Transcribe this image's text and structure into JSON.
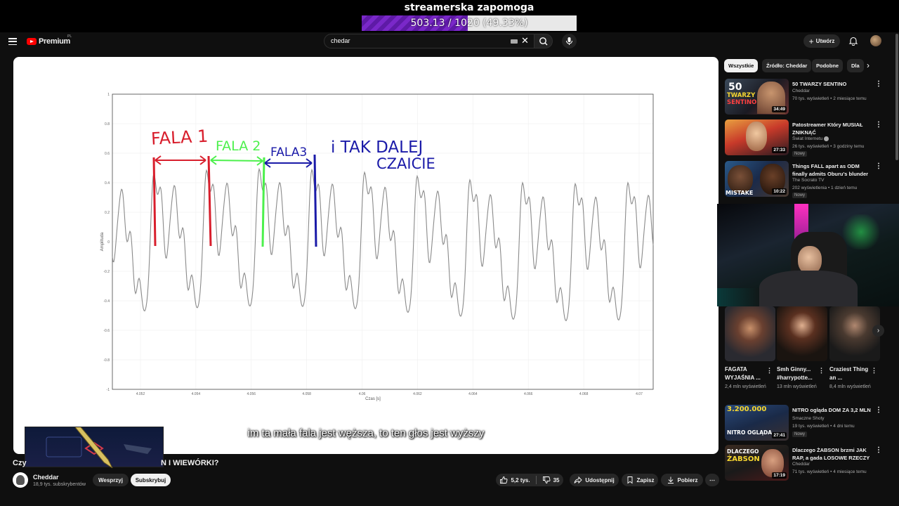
{
  "goal": {
    "title": "streamerska zapomoga",
    "progress_text": "503.13 / 1020 (49.33%)",
    "progress": 0.4933
  },
  "header": {
    "logo_text": "Premium",
    "region": "PL",
    "search_value": "chedar",
    "create_label": "Utwórz"
  },
  "video": {
    "subtitle": "im ta mała fala jest węższa, to ten głos jest wyższy",
    "title_start": "Czy",
    "title_end": "N I WIEWÓRKI?",
    "annotations": {
      "wave1": "FALA 1",
      "wave2": "FALA 2",
      "wave3": "FALA3",
      "rest_line1": "i TAK DALEJ",
      "rest_line2": "CZAICIE"
    }
  },
  "channel": {
    "name": "Cheddar",
    "subs": "18,9 tys. subskrybentów",
    "support_label": "Wesprzyj",
    "subscribe_label": "Subskrybuj"
  },
  "actions": {
    "likes": "5,2 tys.",
    "dislikes": "35",
    "share": "Udostępnij",
    "save": "Zapisz",
    "download": "Pobierz"
  },
  "chips": [
    "Wszystkie",
    "Źródło: Cheddar",
    "Podobne",
    "Dla"
  ],
  "recommendations": [
    {
      "title": "50 TWARZY SENTINO",
      "channel": "Cheddar",
      "meta": "70 tys. wyświetleń • 2 miesiące temu",
      "duration": "34:49",
      "badge": ""
    },
    {
      "title": "Patostreamer Który MUSIAŁ ZNIKNĄĆ",
      "channel": "Świat Internetu",
      "meta": "26 tys. wyświetleń • 3 godziny temu",
      "duration": "27:33",
      "badge": "Nowy"
    },
    {
      "title": "Things FALL apart as ODM finally admits Oburu's blunder",
      "channel": "The Socrato TV",
      "meta": "202 wyświetlenia • 1 dzień temu",
      "duration": "10:22",
      "badge": "Nowy"
    }
  ],
  "thumb_text": {
    "sentino_num": "50",
    "sentino_l1": "TWARZY",
    "sentino_l2": "SENTINO",
    "mistake": "MISTAKE"
  },
  "shorts": [
    {
      "title": "FAGATA WYJAŚNIA ...",
      "views": "2,4 mln wyświetleń"
    },
    {
      "title": "Smh Ginny... #harrypotte...",
      "views": "13 mln wyświetleń"
    },
    {
      "title": "Craziest Thing an ...",
      "views": "8,4 mln wyświetleń"
    }
  ],
  "recommendations_lower": [
    {
      "title": "NITRO ogląda DOM ZA 3,2 MLN",
      "channel": "Smaczne Shoty",
      "meta": "19 tys. wyświetleń • 4 dni temu",
      "duration": "27:41",
      "badge": "Nowy",
      "thumb_top": "3.200.000",
      "thumb_bottom": "NITRO OGLĄDA"
    },
    {
      "title": "Dlaczego ŻABSON brzmi JAK RAP, a gada LOSOWE RZECZY",
      "channel": "Cheddar",
      "meta": "71 tys. wyświetleń • 4 miesiące temu",
      "duration": "17:19",
      "badge": "",
      "thumb_top": "DLACZEGO",
      "thumb_bottom": "ŻABSON"
    }
  ],
  "colors": {
    "accent_red": "#ff0000",
    "goal_purple": "#7a28c9",
    "wave1": "#d81e2c",
    "wave2": "#4cf04c",
    "wave3": "#1a1aa8"
  },
  "chart_data": {
    "type": "line",
    "xlabel": "Czas [s]",
    "ylabel": "Amplituda",
    "ylim": [
      -1,
      1
    ],
    "xticks": [
      "4.052",
      "4.054",
      "4.056",
      "4.058",
      "4.06",
      "4.062",
      "4.064",
      "4.066",
      "4.068",
      "4.07"
    ],
    "yticks": [
      "1",
      "0.8",
      "0.6",
      "0.4",
      "0.2",
      "0",
      "-0.2",
      "-0.4",
      "-0.6",
      "-0.8",
      "-1"
    ],
    "grid": true
  }
}
